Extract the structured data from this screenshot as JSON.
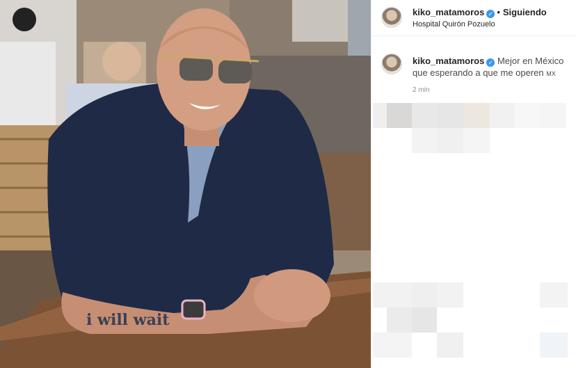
{
  "post": {
    "username": "kiko_matamoros",
    "verified_mark": "✓",
    "separator": "•",
    "follow_status": "Siguiendo",
    "location": "Hospital Quirón Pozuelo",
    "caption": {
      "username": "kiko_matamoros",
      "text": "Mejor en México que esperando a que me operen",
      "flag_text": "MX"
    },
    "time": "2 min"
  },
  "photo": {
    "tattoo_text": "i will wait",
    "icon": "photo-of-man-at-table"
  },
  "colors": {
    "verified_blue": "#3897f0",
    "shirt_navy": "#1f2a47",
    "background_white": "#ffffff"
  }
}
